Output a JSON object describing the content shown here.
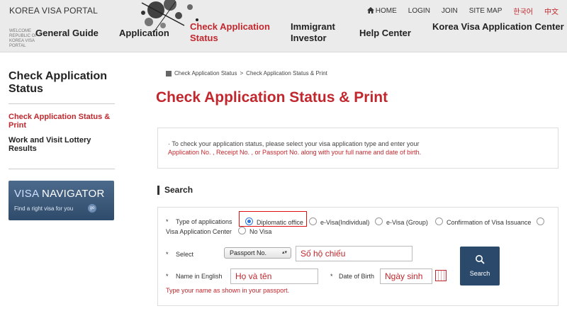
{
  "header": {
    "logo": "KOREA VISA PORTAL",
    "logo_sub": "WELCOME REPUBLIC OF KOREA VISA PORTAL",
    "utility": [
      "HOME",
      "LOGIN",
      "JOIN",
      "SITE MAP",
      "한국어",
      "中文"
    ],
    "nav": [
      "General Guide",
      "Application",
      "Check Application Status",
      "Immigrant Investor",
      "Help Center",
      "Korea Visa Application Center"
    ]
  },
  "sidebar": {
    "title": "Check Application Status",
    "links": [
      "Check Application Status & Print",
      "Work and Visit Lottery Results"
    ],
    "banner_title_a": "VISA",
    "banner_title_b": "NAVIGATOR",
    "banner_sub": "Find a right visa for you",
    "banner_go": "go"
  },
  "breadcrumb": [
    "Check Application Status",
    "Check Application Status & Print"
  ],
  "breadcrumb_sep": ">",
  "page_title": "Check Application Status & Print",
  "notice": {
    "line1": "· To check your application status, please select your visa application type and enter your",
    "line2": "Application No. , Receipt No. , or Passport No. along with your full name and date of birth."
  },
  "section_title": "Search",
  "form": {
    "required_mark": "*",
    "type_label": "Type of applications",
    "options": [
      "Diplomatic office",
      "e-Visa(Individual)",
      "e-Visa (Group)",
      "Confirmation of Visa Issuance",
      "Visa Application Center",
      "No Visa"
    ],
    "selected_option": "Diplomatic office",
    "select_label": "Select",
    "select_value": "Passport No.",
    "number_value": "Số hộ chiếu",
    "name_label": "Name in English",
    "name_value": "Họ và tên",
    "dob_label": "Date of Birth",
    "dob_value": "Ngày sinh",
    "search_button": "Search",
    "hint": "Type your name as shown in your passport."
  },
  "colors": {
    "accent": "#c1272d",
    "navy": "#2b4a6b",
    "radio": "#2b74d8"
  }
}
